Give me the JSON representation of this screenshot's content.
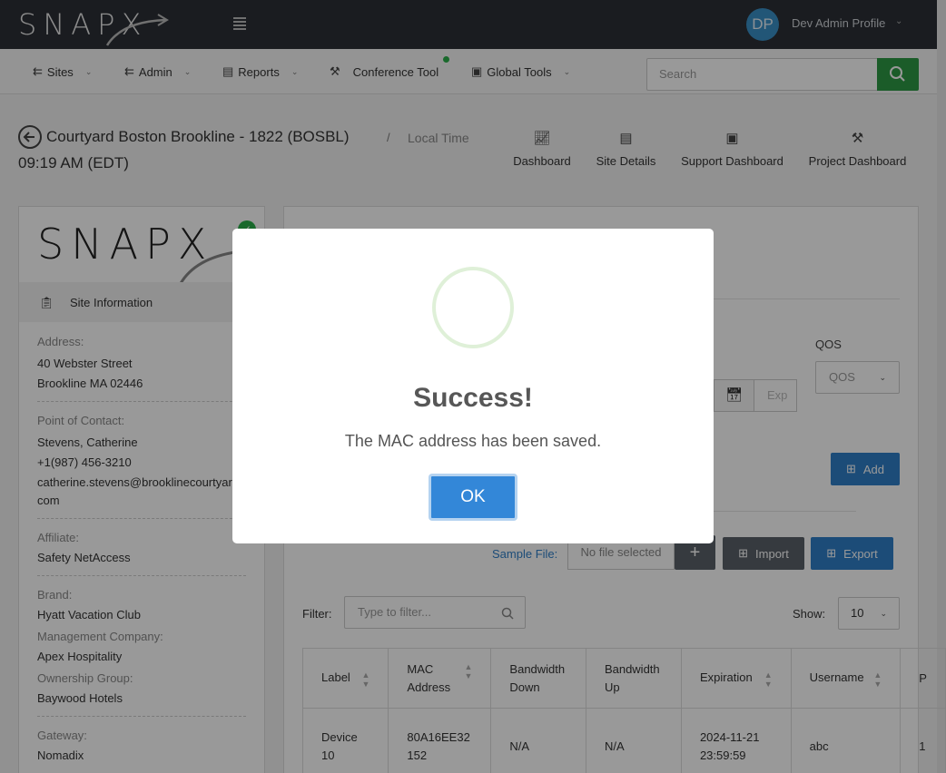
{
  "app": {
    "logo": "SNAPX",
    "profile_initials": "DP",
    "profile_name": "Dev Admin Profile"
  },
  "nav": {
    "items": [
      {
        "label": "Sites",
        "icon": "sites-icon"
      },
      {
        "label": "Admin",
        "icon": "admin-icon"
      },
      {
        "label": "Reports",
        "icon": "chart-icon"
      },
      {
        "label": "Conference Tool",
        "icon": "hammer-icon"
      },
      {
        "label": "Global Tools",
        "icon": "toolbox-icon"
      }
    ],
    "search_placeholder": "Search"
  },
  "header": {
    "site_title": "Courtyard Boston Brookline - 1822 (BOSBL)",
    "separator": "/",
    "local_time_label": "Local Time",
    "local_time": "09:19 AM (EDT)",
    "links": [
      {
        "label": "Dashboard",
        "icon": "line-chart-icon"
      },
      {
        "label": "Site Details",
        "icon": "document-icon"
      },
      {
        "label": "Support Dashboard",
        "icon": "briefcase-icon"
      },
      {
        "label": "Project Dashboard",
        "icon": "hammer-icon"
      }
    ]
  },
  "site_info": {
    "section_label": "Site Information",
    "address_label": "Address:",
    "address_line1": "40 Webster Street",
    "address_line2": "Brookline MA 02446",
    "contact_label": "Point of Contact:",
    "contact_name": "Stevens, Catherine",
    "contact_phone": "+1(987) 456-3210",
    "contact_email_1": "catherine.stevens@brooklinecourtyar",
    "contact_email_2": "com",
    "affiliate_label": "Affiliate:",
    "affiliate": "Safety NetAccess",
    "brand_label": "Brand:",
    "brand": "Hyatt Vacation Club",
    "mgmt_label": "Management Company:",
    "mgmt": "Apex Hospitality",
    "ownership_label": "Ownership Group:",
    "ownership": "Baywood Hotels",
    "gateway_label": "Gateway:",
    "gateway": "Nomadix"
  },
  "form": {
    "qos_label": "QOS",
    "qos_placeholder": "QOS",
    "exp_placeholder": "Exp",
    "add_label": "Add",
    "sample_file_label": "Sample File:",
    "file_status": "No file selected",
    "import_label": "Import",
    "export_label": "Export",
    "filter_label": "Filter:",
    "filter_placeholder": "Type to filter...",
    "show_label": "Show:",
    "show_value": "10"
  },
  "table": {
    "headers": [
      "Label",
      "MAC Address",
      "Bandwidth Down",
      "Bandwidth Up",
      "Expiration",
      "Username",
      "P"
    ],
    "rows": [
      [
        "Device 10",
        "80A16EE32152",
        "N/A",
        "N/A",
        "2024-11-21 23:59:59",
        "abc",
        "1"
      ]
    ]
  },
  "modal": {
    "title": "Success!",
    "message": "The MAC address has been saved.",
    "ok_label": "OK"
  }
}
